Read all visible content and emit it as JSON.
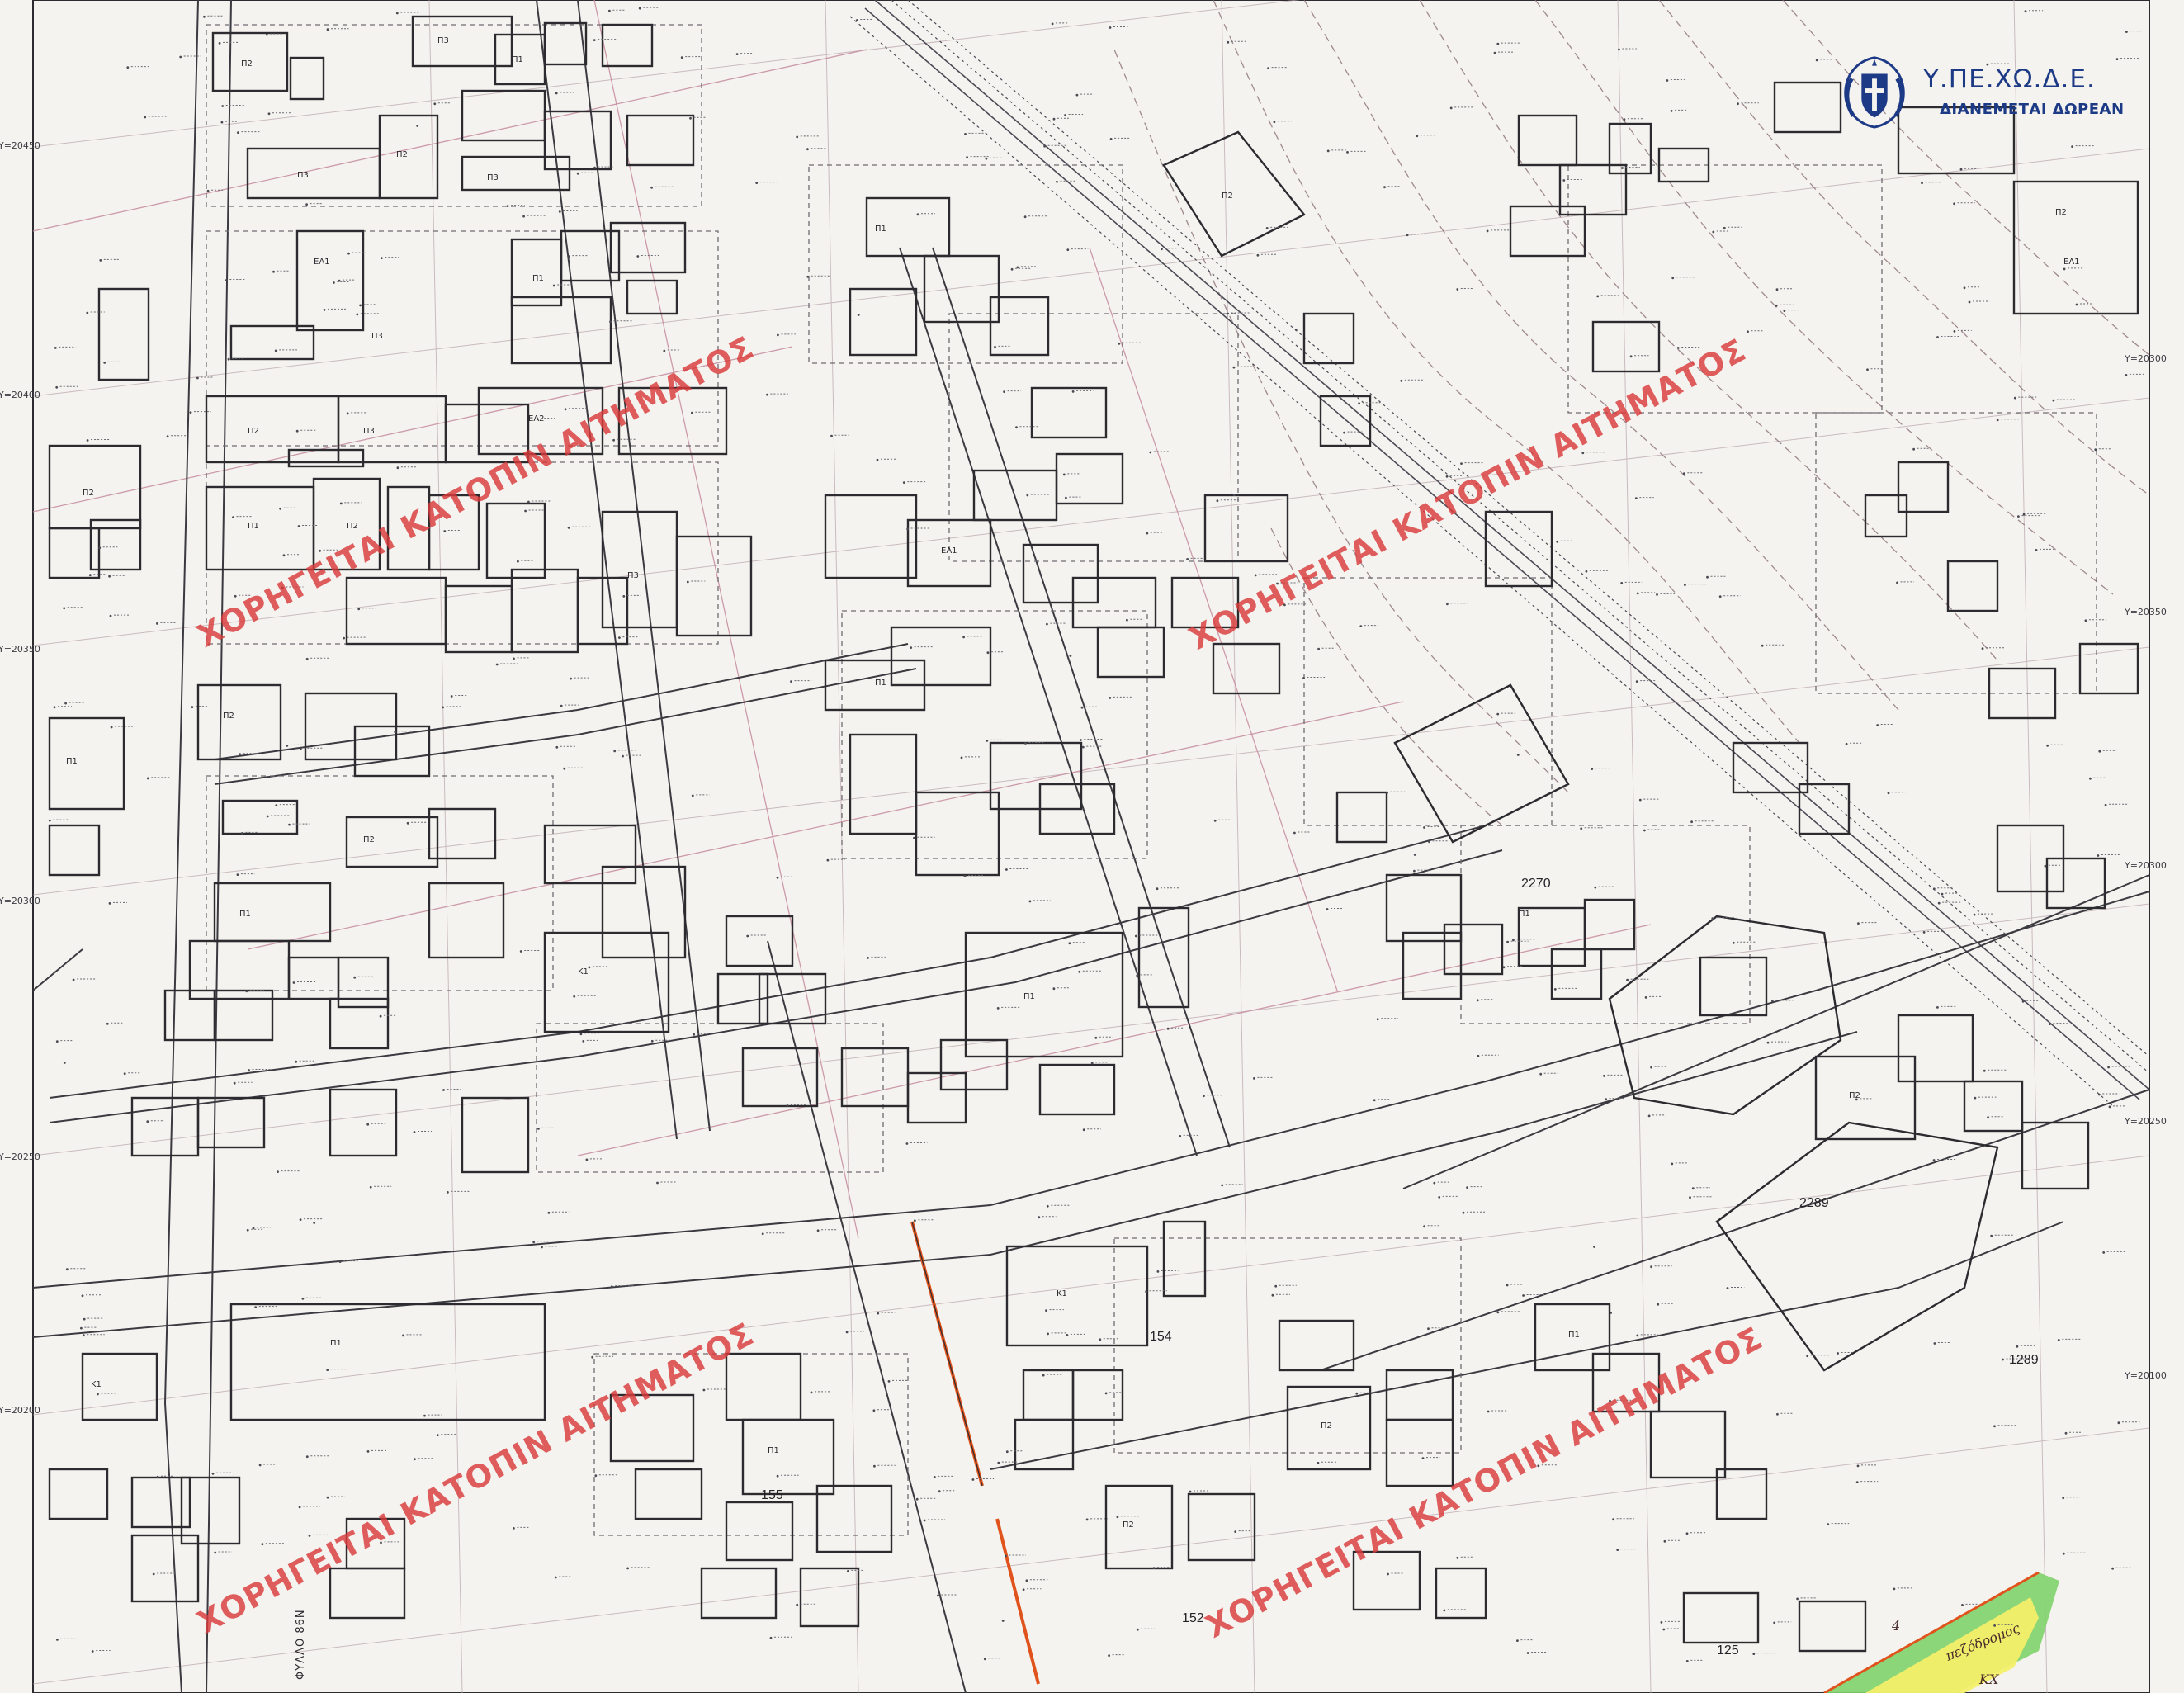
{
  "map": {
    "sheet_label": "ΦΥΛΛΟ 86N",
    "logo": {
      "title": "Υ.ΠΕ.ΧΩ.Δ.Ε.",
      "subtitle": "ΔΙΑΝΕΜΕΤΑΙ ΔΩΡΕΑΝ",
      "emblem": "greek-coat-of-arms-icon"
    },
    "watermark_text": "ΧΟΡΗΓΕΙΤΑΙ ΚΑΤΟΠΙΝ ΑΙΤΗΜΑΤΟΣ",
    "block_numbers": [
      "2270",
      "2289",
      "154",
      "155",
      "152",
      "1289",
      "125"
    ],
    "grid_labels_left": [
      "Y=20450",
      "Y=20400",
      "Y=20350",
      "Y=20300",
      "Y=20250",
      "Y=20200"
    ],
    "grid_labels_right": [
      "Y=20300",
      "Y=20350",
      "Y=20300",
      "Y=20250",
      "Y=20100"
    ],
    "handwritten_labels": [
      "πεζόδρομος",
      "ΚΧ",
      "4"
    ],
    "building_codes": [
      "Π1",
      "Π2",
      "Π3",
      "ΕΛ1",
      "ΕΛ2",
      "Κ1"
    ],
    "colors": {
      "paper": "#f4f3ef",
      "ink": "#2b2b30",
      "watermark": "#d93a3a",
      "logo_blue": "#1d3a86",
      "orange_line": "#e0531c",
      "green_zone": "#7fd36a",
      "yellow_zone": "#f3ef6a"
    }
  }
}
